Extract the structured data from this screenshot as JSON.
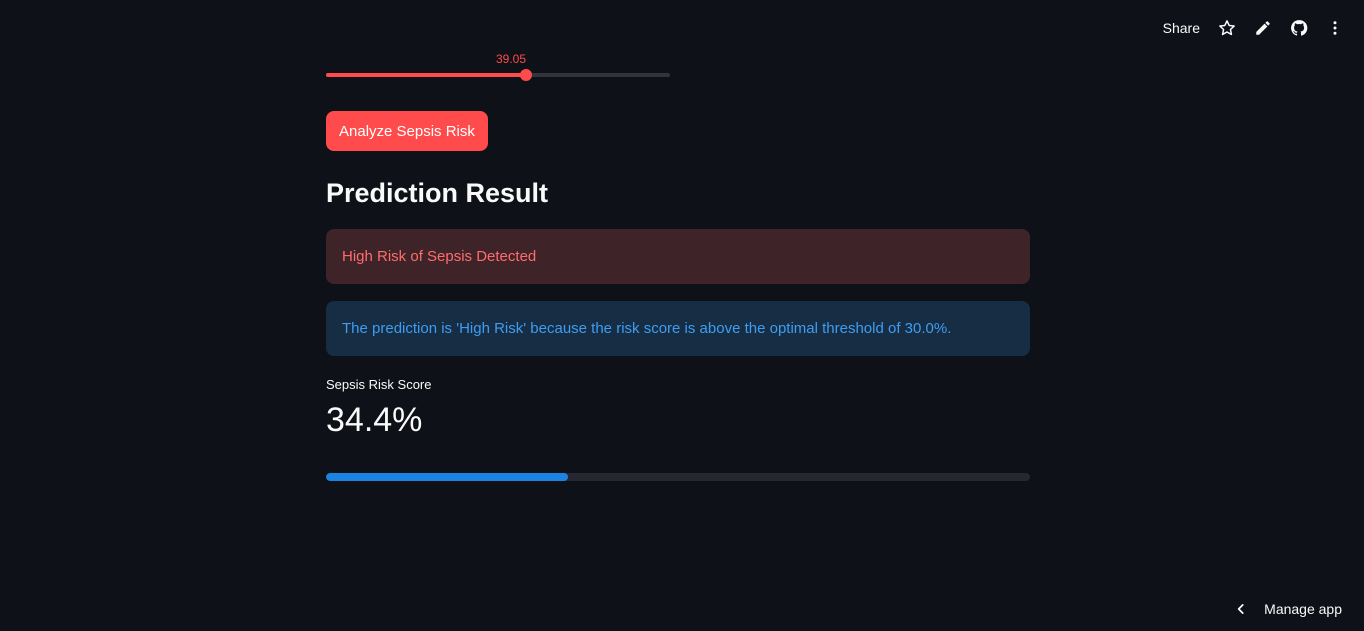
{
  "toolbar": {
    "share_label": "Share",
    "icons": [
      "star-icon",
      "pencil-icon",
      "github-icon",
      "more-vertical-icon"
    ]
  },
  "slider": {
    "value_label": "39.05",
    "fill_fraction": 0.58,
    "color": "#ff4b4b"
  },
  "analyze_button": {
    "label": "Analyze Sepsis Risk"
  },
  "result": {
    "heading": "Prediction Result",
    "error_alert": "High Risk of Sepsis Detected",
    "info_alert": "The prediction is 'High Risk' because the risk score is above the optimal threshold of 30.0%."
  },
  "metric": {
    "label": "Sepsis Risk Score",
    "value": "34.4%",
    "progress_fraction": 0.344
  },
  "footer": {
    "manage_app_label": "Manage app",
    "icon": "chevron-left-icon"
  },
  "colors": {
    "background": "#0e1117",
    "accent": "#ff4b4b",
    "info": "#3d9df3",
    "progress": "#1c83e1"
  }
}
